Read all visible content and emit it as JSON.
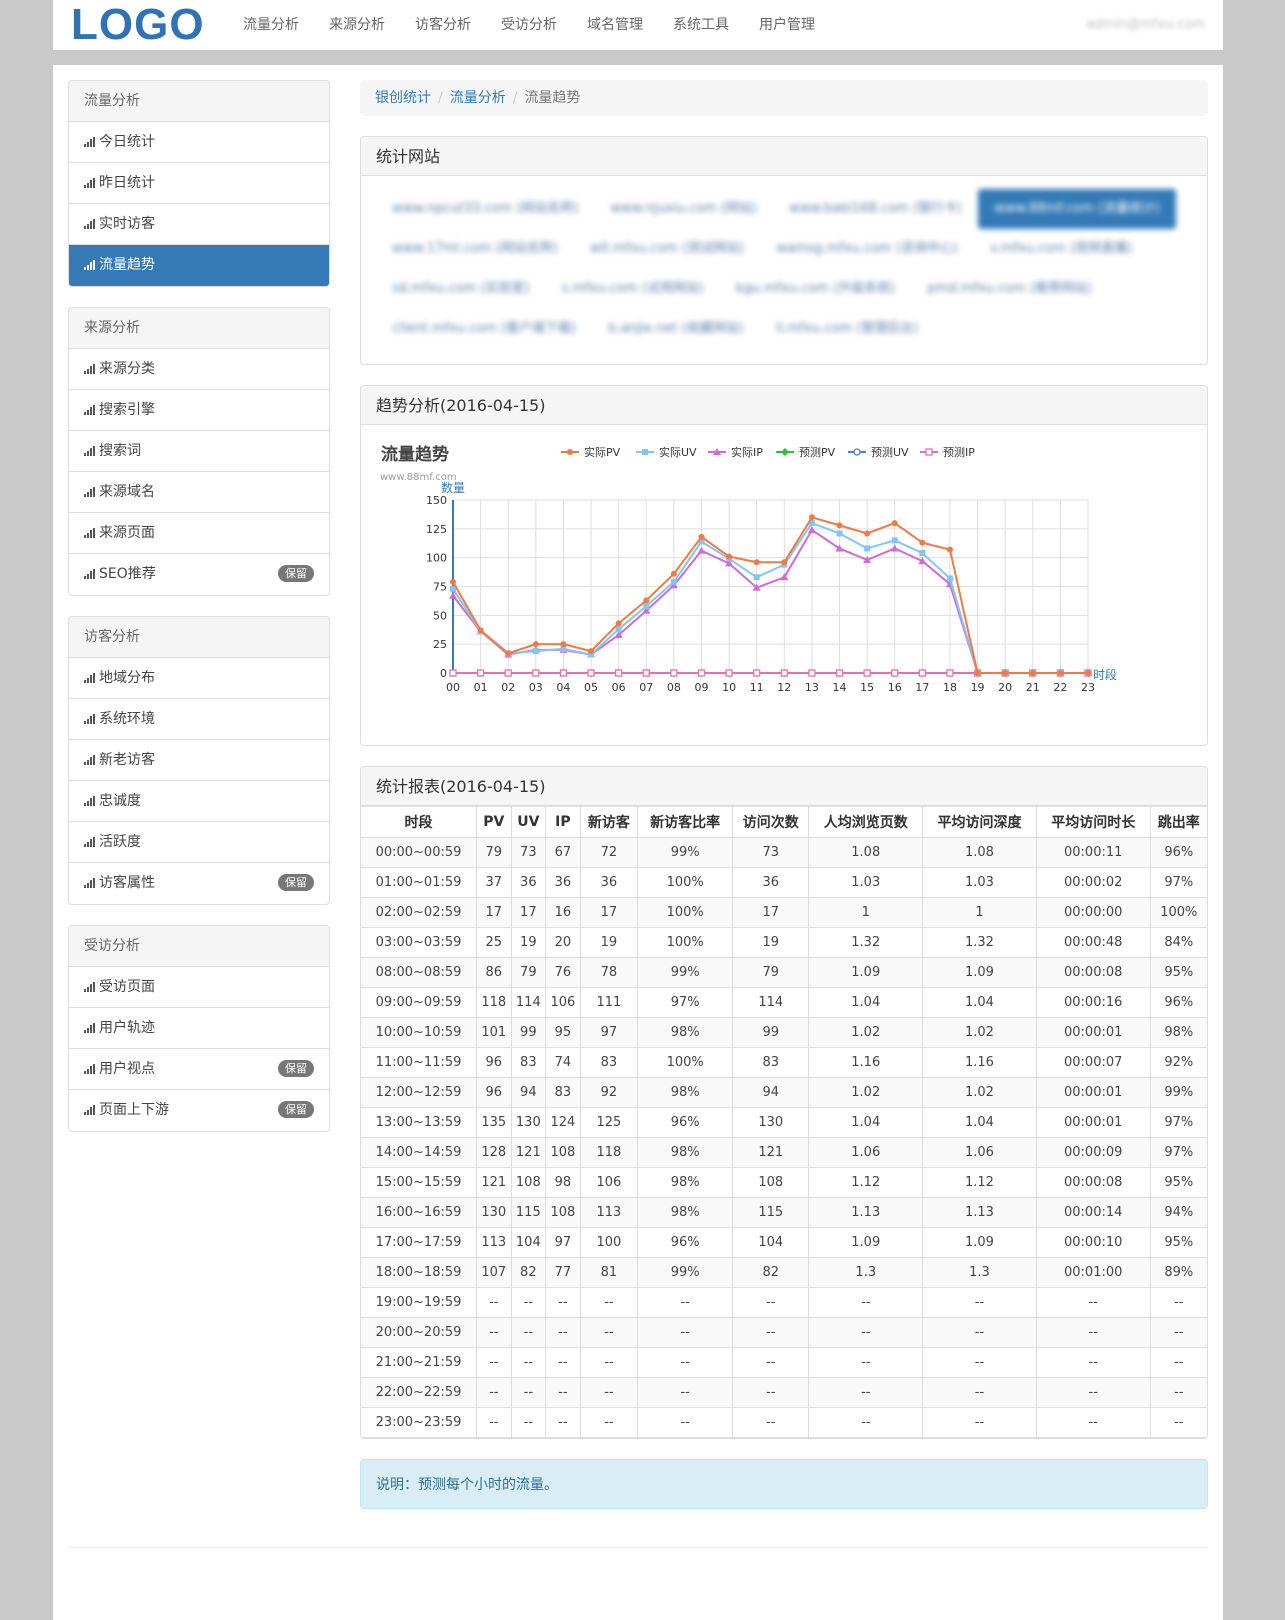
{
  "header": {
    "logo": "LOGO",
    "nav": [
      "流量分析",
      "来源分析",
      "访客分析",
      "受访分析",
      "域名管理",
      "系统工具",
      "用户管理"
    ],
    "user": "admin@mfxu.com"
  },
  "sidebar": [
    {
      "title": "流量分析",
      "items": [
        {
          "label": "今日统计"
        },
        {
          "label": "昨日统计"
        },
        {
          "label": "实时访客"
        },
        {
          "label": "流量趋势",
          "active": true
        }
      ]
    },
    {
      "title": "来源分析",
      "items": [
        {
          "label": "来源分类"
        },
        {
          "label": "搜索引擎"
        },
        {
          "label": "搜索词"
        },
        {
          "label": "来源域名"
        },
        {
          "label": "来源页面"
        },
        {
          "label": "SEO推荐",
          "badge": "保留"
        }
      ]
    },
    {
      "title": "访客分析",
      "items": [
        {
          "label": "地域分布"
        },
        {
          "label": "系统环境"
        },
        {
          "label": "新老访客"
        },
        {
          "label": "忠诚度"
        },
        {
          "label": "活跃度"
        },
        {
          "label": "访客属性",
          "badge": "保留"
        }
      ]
    },
    {
      "title": "受访分析",
      "items": [
        {
          "label": "受访页面"
        },
        {
          "label": "用户轨迹"
        },
        {
          "label": "用户视点",
          "badge": "保留"
        },
        {
          "label": "页面上下游",
          "badge": "保留"
        }
      ]
    }
  ],
  "breadcrumb": {
    "home": "银创统计",
    "section": "流量分析",
    "current": "流量趋势"
  },
  "sites_panel": {
    "title": "统计网站",
    "sites": [
      {
        "label": "www.npcut33.com (网站名称)"
      },
      {
        "label": "www.njuxiu.com (网站)"
      },
      {
        "label": "www.babi168.com (银行卡)"
      },
      {
        "label": "www.88mf.com (流量统计)",
        "selected": true
      },
      {
        "label": "www.17ml.com (网站名称)"
      },
      {
        "label": "w0.mfxu.com (测试网站)"
      },
      {
        "label": "wamsg.mfxu.com (咨询中心)"
      },
      {
        "label": "v.mfxu.com (视频直播)"
      },
      {
        "label": "sd.mfxu.com (实验室)"
      },
      {
        "label": "s.mfxu.com (试用网站)"
      },
      {
        "label": "kgu.mfxu.com (升级系统)"
      },
      {
        "label": "pmd.mfxu.com (推荐网站)"
      },
      {
        "label": "client.mfxu.com (客户端下载)"
      },
      {
        "label": "b.anjie.net (收藏网站)"
      },
      {
        "label": "li.mfxu.com (管理后台)"
      }
    ]
  },
  "trend_panel": {
    "title": "趋势分析(2016-04-15)"
  },
  "chart_data": {
    "type": "line",
    "title": "流量趋势",
    "subtitle": "www.88mf.com",
    "ylabel": "数量",
    "xlabel": "时段",
    "ylim": [
      0,
      150
    ],
    "yticks": [
      0,
      25,
      50,
      75,
      100,
      125,
      150
    ],
    "categories": [
      "00",
      "01",
      "02",
      "03",
      "04",
      "05",
      "06",
      "07",
      "08",
      "09",
      "10",
      "11",
      "12",
      "13",
      "14",
      "15",
      "16",
      "17",
      "18",
      "19",
      "20",
      "21",
      "22",
      "23"
    ],
    "series": [
      {
        "name": "实际PV",
        "color": "#f07a42",
        "marker": "circle",
        "values": [
          79,
          37,
          17,
          25,
          25,
          19,
          43,
          63,
          86,
          118,
          101,
          96,
          96,
          135,
          128,
          121,
          130,
          113,
          107,
          0,
          0,
          0,
          0,
          0
        ]
      },
      {
        "name": "实际UV",
        "color": "#83c6f2",
        "marker": "square",
        "values": [
          73,
          36,
          17,
          19,
          21,
          16,
          38,
          58,
          79,
          114,
          99,
          83,
          94,
          130,
          121,
          108,
          115,
          104,
          82,
          0,
          0,
          0,
          0,
          0
        ]
      },
      {
        "name": "实际IP",
        "color": "#d06bd6",
        "marker": "triangle",
        "values": [
          67,
          36,
          16,
          20,
          20,
          16,
          33,
          54,
          76,
          106,
          95,
          74,
          83,
          124,
          108,
          98,
          108,
          97,
          77,
          0,
          0,
          0,
          0,
          0
        ]
      },
      {
        "name": "预测PV",
        "color": "#3cb83c",
        "marker": "diamond",
        "values": [
          0,
          0,
          0,
          0,
          0,
          0,
          0,
          0,
          0,
          0,
          0,
          0,
          0,
          0,
          0,
          0,
          0,
          0,
          0,
          0,
          0,
          0,
          0,
          0
        ]
      },
      {
        "name": "预测UV",
        "color": "#4f7fd6",
        "marker": "circle-open",
        "values": [
          0,
          0,
          0,
          0,
          0,
          0,
          0,
          0,
          0,
          0,
          0,
          0,
          0,
          0,
          0,
          0,
          0,
          0,
          0,
          0,
          0,
          0,
          0,
          0
        ]
      },
      {
        "name": "预测IP",
        "color": "#e86fae",
        "marker": "square-open",
        "values": [
          0,
          0,
          0,
          0,
          0,
          0,
          0,
          0,
          0,
          0,
          0,
          0,
          0,
          0,
          0,
          0,
          0,
          0,
          0,
          0,
          0,
          0,
          0,
          0
        ]
      }
    ],
    "grid": true,
    "legend_position": "top"
  },
  "report_panel": {
    "title": "统计报表(2016-04-15)",
    "columns": [
      "时段",
      "PV",
      "UV",
      "IP",
      "新访客",
      "新访客比率",
      "访问次数",
      "人均浏览页数",
      "平均访问深度",
      "平均访问时长",
      "跳出率"
    ],
    "rows": [
      [
        "00:00~00:59",
        "79",
        "73",
        "67",
        "72",
        "99%",
        "73",
        "1.08",
        "1.08",
        "00:00:11",
        "96%"
      ],
      [
        "01:00~01:59",
        "37",
        "36",
        "36",
        "36",
        "100%",
        "36",
        "1.03",
        "1.03",
        "00:00:02",
        "97%"
      ],
      [
        "02:00~02:59",
        "17",
        "17",
        "16",
        "17",
        "100%",
        "17",
        "1",
        "1",
        "00:00:00",
        "100%"
      ],
      [
        "03:00~03:59",
        "25",
        "19",
        "20",
        "19",
        "100%",
        "19",
        "1.32",
        "1.32",
        "00:00:48",
        "84%"
      ],
      [
        "08:00~08:59",
        "86",
        "79",
        "76",
        "78",
        "99%",
        "79",
        "1.09",
        "1.09",
        "00:00:08",
        "95%"
      ],
      [
        "09:00~09:59",
        "118",
        "114",
        "106",
        "111",
        "97%",
        "114",
        "1.04",
        "1.04",
        "00:00:16",
        "96%"
      ],
      [
        "10:00~10:59",
        "101",
        "99",
        "95",
        "97",
        "98%",
        "99",
        "1.02",
        "1.02",
        "00:00:01",
        "98%"
      ],
      [
        "11:00~11:59",
        "96",
        "83",
        "74",
        "83",
        "100%",
        "83",
        "1.16",
        "1.16",
        "00:00:07",
        "92%"
      ],
      [
        "12:00~12:59",
        "96",
        "94",
        "83",
        "92",
        "98%",
        "94",
        "1.02",
        "1.02",
        "00:00:01",
        "99%"
      ],
      [
        "13:00~13:59",
        "135",
        "130",
        "124",
        "125",
        "96%",
        "130",
        "1.04",
        "1.04",
        "00:00:01",
        "97%"
      ],
      [
        "14:00~14:59",
        "128",
        "121",
        "108",
        "118",
        "98%",
        "121",
        "1.06",
        "1.06",
        "00:00:09",
        "97%"
      ],
      [
        "15:00~15:59",
        "121",
        "108",
        "98",
        "106",
        "98%",
        "108",
        "1.12",
        "1.12",
        "00:00:08",
        "95%"
      ],
      [
        "16:00~16:59",
        "130",
        "115",
        "108",
        "113",
        "98%",
        "115",
        "1.13",
        "1.13",
        "00:00:14",
        "94%"
      ],
      [
        "17:00~17:59",
        "113",
        "104",
        "97",
        "100",
        "96%",
        "104",
        "1.09",
        "1.09",
        "00:00:10",
        "95%"
      ],
      [
        "18:00~18:59",
        "107",
        "82",
        "77",
        "81",
        "99%",
        "82",
        "1.3",
        "1.3",
        "00:01:00",
        "89%"
      ],
      [
        "19:00~19:59",
        "--",
        "--",
        "--",
        "--",
        "--",
        "--",
        "--",
        "--",
        "--",
        "--"
      ],
      [
        "20:00~20:59",
        "--",
        "--",
        "--",
        "--",
        "--",
        "--",
        "--",
        "--",
        "--",
        "--"
      ],
      [
        "21:00~21:59",
        "--",
        "--",
        "--",
        "--",
        "--",
        "--",
        "--",
        "--",
        "--",
        "--"
      ],
      [
        "22:00~22:59",
        "--",
        "--",
        "--",
        "--",
        "--",
        "--",
        "--",
        "--",
        "--",
        "--"
      ],
      [
        "23:00~23:59",
        "--",
        "--",
        "--",
        "--",
        "--",
        "--",
        "--",
        "--",
        "--",
        "--"
      ]
    ]
  },
  "note": "说明：预测每个小时的流量。"
}
